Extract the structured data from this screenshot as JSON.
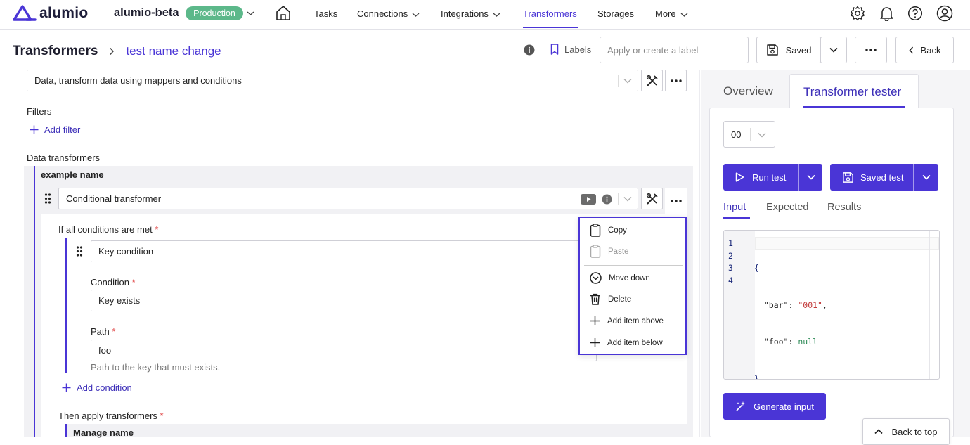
{
  "brand": {
    "logo_text": "alumio",
    "project": "alumio-beta",
    "env_badge": "Production"
  },
  "nav": {
    "home_icon": "home-icon",
    "tasks": "Tasks",
    "connections": "Connections",
    "integrations": "Integrations",
    "transformers": "Transformers",
    "storages": "Storages",
    "more": "More"
  },
  "header_icons": [
    "gear-icon",
    "bell-icon",
    "help-icon",
    "user-icon"
  ],
  "breadcrumb": {
    "section": "Transformers",
    "current": "test name change"
  },
  "toolbar": {
    "labels": "Labels",
    "label_placeholder": "Apply or create a label",
    "saved": "Saved",
    "back": "Back"
  },
  "editor": {
    "transformer_type": "Data, transform data using mappers and conditions",
    "filters_title": "Filters",
    "add_filter": "Add filter",
    "data_transformers_title": "Data transformers",
    "item_name": "example name",
    "item_type": "Conditional transformer",
    "conditions_title": "If all conditions are met",
    "condition_name": "Key condition",
    "condition_label": "Condition",
    "condition_value": "Key exists",
    "path_label": "Path",
    "path_value": "foo",
    "path_help": "Path to the key that must exists.",
    "add_condition": "Add condition",
    "then_title": "Then apply transformers",
    "manage_name": "Manage name"
  },
  "context_menu": {
    "copy": "Copy",
    "paste": "Paste",
    "move_down": "Move down",
    "delete": "Delete",
    "add_above": "Add item above",
    "add_below": "Add item below"
  },
  "tester": {
    "tab_overview": "Overview",
    "tab_tester": "Transformer tester",
    "selector_value": "00",
    "run_test": "Run test",
    "saved_test": "Saved test",
    "sub_input": "Input",
    "sub_expected": "Expected",
    "sub_results": "Results",
    "line_numbers": [
      "1",
      "2",
      "3",
      "4"
    ],
    "code": {
      "open": "{",
      "bar_key": "\"bar\"",
      "bar_val": "\"001\"",
      "foo_key": "\"foo\"",
      "foo_val": "null",
      "close": "}",
      "colon": ":",
      "comma": ","
    },
    "generate_input": "Generate input",
    "back_to_top": "Back to top"
  },
  "colors": {
    "accent": "#4a35d6",
    "badge": "#5cb88a",
    "required": "#dd3333",
    "code_string": "#c23a3a",
    "code_null": "#2e8b57"
  }
}
